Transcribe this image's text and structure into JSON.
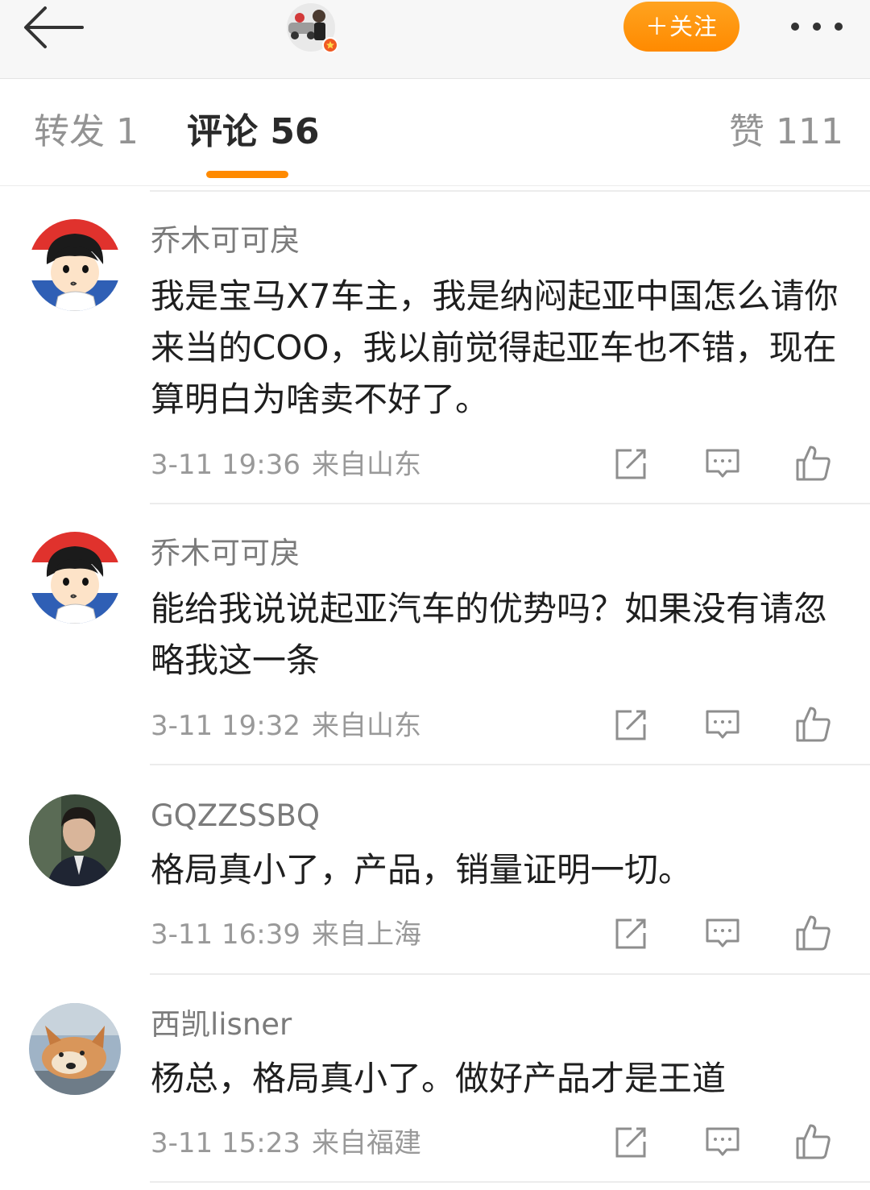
{
  "header": {
    "back_icon": "arrow-left-icon",
    "follow_label": "＋关注",
    "more_icon": "more-dots-icon",
    "accent_color": "#ff8a00"
  },
  "tabs": [
    {
      "label": "转发 1",
      "active": false
    },
    {
      "label": "评论 56",
      "active": true
    },
    {
      "label": "赞 111",
      "active": false
    }
  ],
  "comments": [
    {
      "username": "乔木可可戾",
      "text": "我是宝马X7车主，我是纳闷起亚中国怎么请你来当的COO，我以前觉得起亚车也不错，现在算明白为啥卖不好了。",
      "time": "3-11 19:36",
      "location": "来自山东",
      "avatar": "cartoon-boy-avatar"
    },
    {
      "username": "乔木可可戾",
      "text": "能给我说说起亚汽车的优势吗？如果没有请忽略我这一条",
      "time": "3-11 19:32",
      "location": "来自山东",
      "avatar": "cartoon-boy-avatar"
    },
    {
      "username": "GQZZSSBQ",
      "text": "格局真小了，产品，销量证明一切。",
      "time": "3-11 16:39",
      "location": "来自上海",
      "avatar": "man-photo-avatar"
    },
    {
      "username": "西凯lisner",
      "text": "杨总，格局真小了。做好产品才是王道",
      "time": "3-11 15:23",
      "location": "来自福建",
      "avatar": "dog-photo-avatar"
    }
  ],
  "action_icons": [
    "share-icon",
    "reply-icon",
    "like-icon"
  ]
}
